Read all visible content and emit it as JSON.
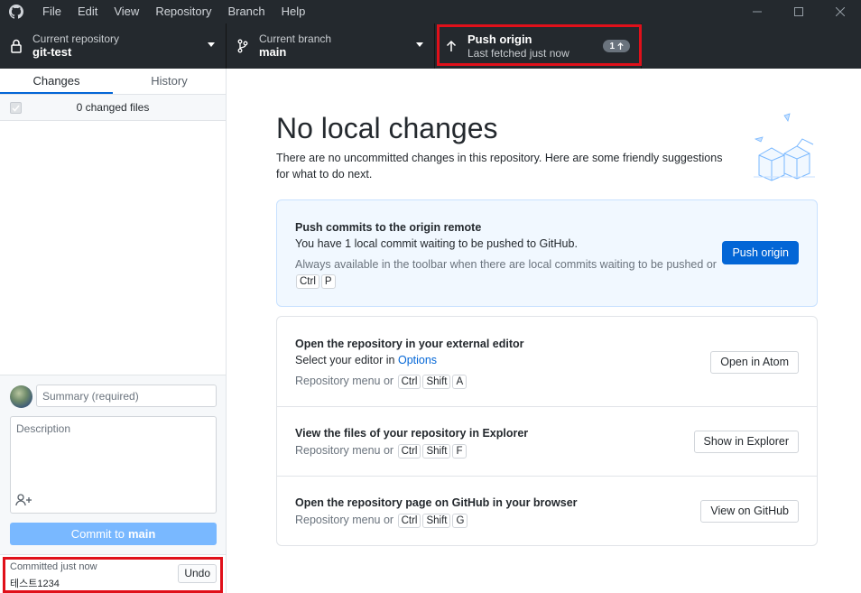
{
  "menu": {
    "items": [
      "File",
      "Edit",
      "View",
      "Repository",
      "Branch",
      "Help"
    ]
  },
  "toolbar": {
    "repo_label": "Current repository",
    "repo_value": "git-test",
    "branch_label": "Current branch",
    "branch_value": "main",
    "push_label": "Push origin",
    "push_sub": "Last fetched just now",
    "push_badge": "1"
  },
  "sidebar": {
    "tabs": [
      "Changes",
      "History"
    ],
    "changed_files": "0 changed files",
    "summary_placeholder": "Summary (required)",
    "description_placeholder": "Description",
    "commit_prefix": "Commit to",
    "commit_branch": "main",
    "undo_title": "Committed just now",
    "undo_message": "테스트1234",
    "undo_button": "Undo"
  },
  "main": {
    "title": "No local changes",
    "subtitle": "There are no uncommitted changes in this repository. Here are some friendly suggestions for what to do next.",
    "push_card": {
      "title": "Push commits to the origin remote",
      "desc": "You have 1 local commit waiting to be pushed to GitHub.",
      "hint": "Always available in the toolbar when there are local commits waiting to be pushed",
      "hint_or": "or",
      "keys": [
        "Ctrl",
        "P"
      ],
      "button": "Push origin"
    },
    "editor": {
      "title": "Open the repository in your external editor",
      "desc_prefix": "Select your editor in",
      "desc_link": "Options",
      "hint": "Repository menu or",
      "keys": [
        "Ctrl",
        "Shift",
        "A"
      ],
      "button": "Open in Atom"
    },
    "explorer": {
      "title": "View the files of your repository in Explorer",
      "hint": "Repository menu or",
      "keys": [
        "Ctrl",
        "Shift",
        "F"
      ],
      "button": "Show in Explorer"
    },
    "github": {
      "title": "Open the repository page on GitHub in your browser",
      "hint": "Repository menu or",
      "keys": [
        "Ctrl",
        "Shift",
        "G"
      ],
      "button": "View on GitHub"
    }
  },
  "colors": {
    "toolbar_bg": "#24292e",
    "accent": "#0366d6",
    "commit_button": "#79b8ff",
    "highlight": "#e0101a"
  }
}
